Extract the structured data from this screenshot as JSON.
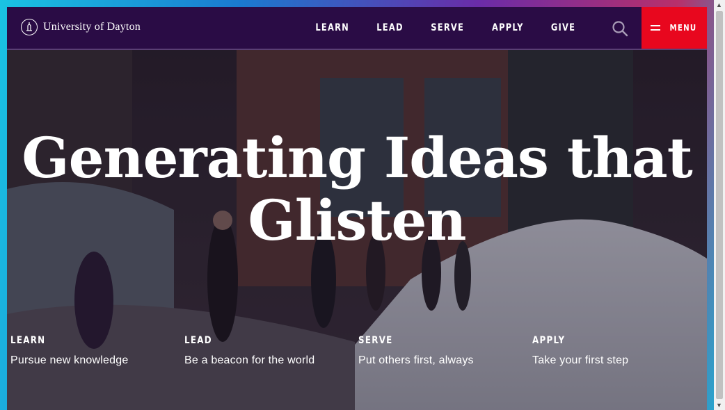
{
  "header": {
    "logo_text": "University of Dayton",
    "nav": [
      "LEARN",
      "LEAD",
      "SERVE",
      "APPLY",
      "GIVE"
    ],
    "search_icon": "search-icon",
    "menu_label": "MENU"
  },
  "hero": {
    "headline": "Generating Ideas that Glisten",
    "pillars": [
      {
        "title": "LEARN",
        "desc": "Pursue new knowledge"
      },
      {
        "title": "LEAD",
        "desc": "Be a beacon for the world"
      },
      {
        "title": "SERVE",
        "desc": "Put others first, always"
      },
      {
        "title": "APPLY",
        "desc": "Take your first step"
      }
    ]
  },
  "colors": {
    "header_bg": "#2a0c45",
    "menu_button": "#e8071e"
  }
}
